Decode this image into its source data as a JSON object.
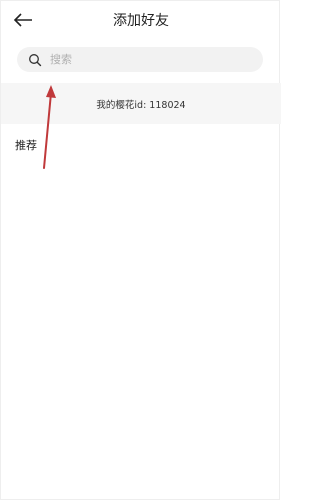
{
  "header": {
    "title": "添加好友",
    "back_icon": "arrow-left-icon"
  },
  "search": {
    "placeholder": "搜索",
    "value": "",
    "icon": "search-icon"
  },
  "my_id": {
    "text": "我的樱花id: 118024"
  },
  "recommend": {
    "label": "推荐"
  },
  "colors": {
    "annotation_arrow": "#c0393b"
  }
}
